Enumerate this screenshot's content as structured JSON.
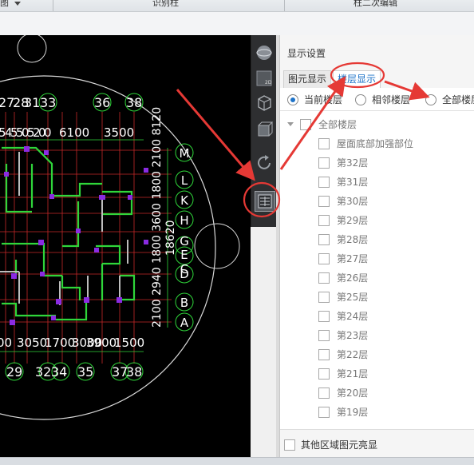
{
  "topbar": {
    "left_label": "图",
    "center_label": "识别柱",
    "right_label": "柱二次编辑"
  },
  "canvas": {
    "top_numbers": [
      "27",
      "28",
      "31",
      "33",
      "36",
      "38"
    ],
    "top_dims": [
      "5",
      "4",
      "5",
      "5",
      "0",
      "5",
      "2",
      "0",
      "0",
      "6100",
      "3500"
    ],
    "bottom_numbers": [
      "29",
      "32",
      "34",
      "35",
      "37",
      "38"
    ],
    "bottom_dims": [
      "00",
      "3050",
      "1700",
      "3000",
      "3900",
      "1500"
    ],
    "right_letters": [
      "M",
      "L",
      "K",
      "H",
      "G",
      "E",
      "D",
      "C",
      "B",
      "A"
    ],
    "right_dims_col1": "2100 2940 1800 3600 1800 2100 8120",
    "right_dims_col2": "18620"
  },
  "panel": {
    "title": "显示设置",
    "tabs": [
      "图元显示",
      "楼层显示"
    ],
    "active_tab": 1,
    "radios": [
      "当前楼层",
      "相邻楼层",
      "全部楼层"
    ],
    "selected_radio": 0,
    "tree_root": "全部楼层",
    "tree_items": [
      "屋面底部加强部位",
      "第32层",
      "第31层",
      "第30层",
      "第29层",
      "第28层",
      "第27层",
      "第26层",
      "第25层",
      "第24层",
      "第23层",
      "第22层",
      "第21层",
      "第20层",
      "第19层"
    ],
    "bottom_checkbox": "其他区域图元亮显"
  },
  "colors": {
    "canvas_bg": "#000000",
    "annotation_red": "#e53935",
    "active_tab": "#1e73c8",
    "grid_green": "#2fd63a",
    "wall_purple": "#8a2be2"
  },
  "icons": {
    "toolbar": [
      "sphere-view-icon",
      "2d-view-icon",
      "3d-box-icon",
      "3d-solid-icon",
      "rotate-icon",
      "floor-display-icon"
    ]
  }
}
